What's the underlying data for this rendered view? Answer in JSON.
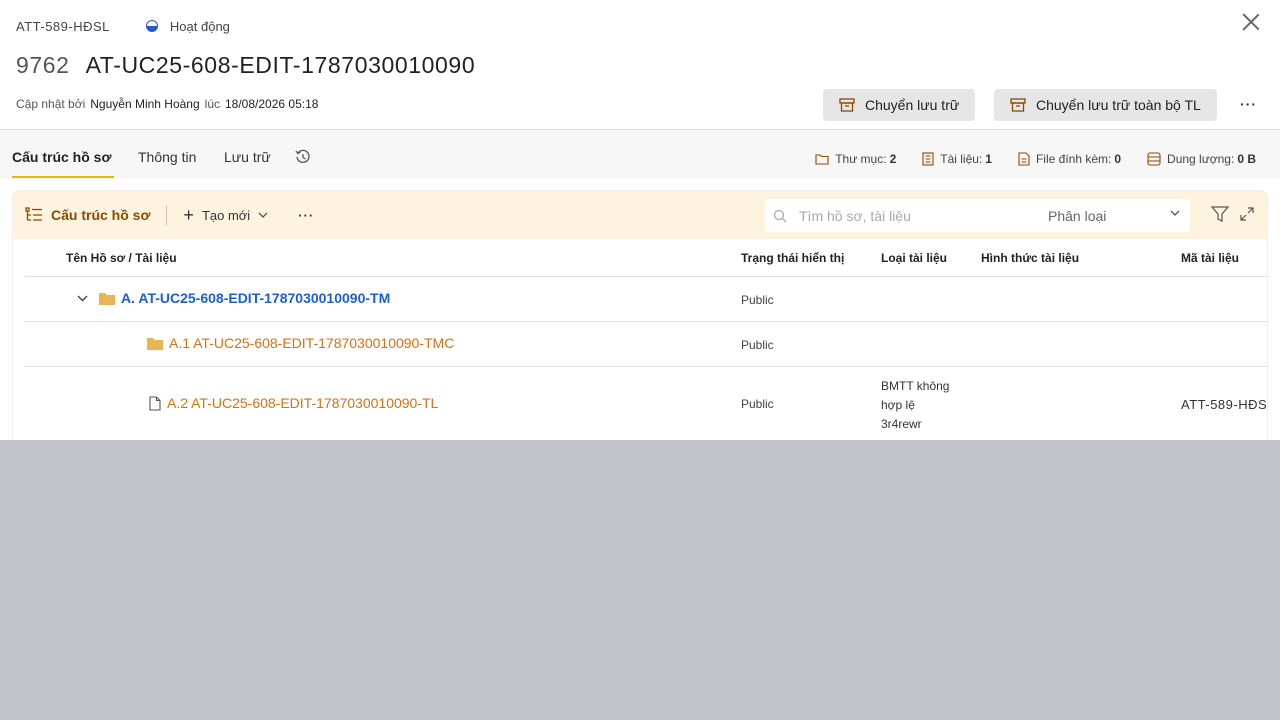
{
  "header": {
    "code": "ATT-589-HĐSL",
    "status": "Hoạt động",
    "number": "9762",
    "title": "AT-UC25-608-EDIT-1787030010090",
    "updated_prefix": "Cập nhật bởi",
    "updated_by": "Nguyễn Minh Hoàng",
    "updated_at_prefix": "lúc",
    "updated_at": "18/08/2026 05:18",
    "btn_archive": "Chuyển lưu trữ",
    "btn_archive_all": "Chuyển lưu trữ toàn bộ TL",
    "more": "···"
  },
  "tabs": [
    {
      "label": "Cấu trúc hồ sơ",
      "active": true
    },
    {
      "label": "Thông tin"
    },
    {
      "label": "Lưu trữ"
    }
  ],
  "stats": [
    {
      "label": "Thư mục:",
      "value": "2",
      "icon": "folder-icon"
    },
    {
      "label": "Tài liệu:",
      "value": "1",
      "icon": "document-icon"
    },
    {
      "label": "File đính kèm:",
      "value": "0",
      "icon": "attachment-icon"
    },
    {
      "label": "Dung lượng:",
      "value": "0 B",
      "icon": "storage-icon"
    }
  ],
  "toolbar": {
    "title": "Cấu trúc hồ sơ",
    "new_label": "Tạo mới",
    "dots": "···",
    "search_placeholder": "Tìm hồ sơ, tài liệu",
    "category_placeholder": "Phân loại"
  },
  "table": {
    "columns": [
      "Tên Hồ sơ / Tài liệu",
      "Trạng thái hiển thị",
      "Loại tài liệu",
      "Hình thức tài liệu",
      "Mã tài liệu"
    ],
    "rows": [
      {
        "name": "A. AT-UC25-608-EDIT-1787030010090-TM",
        "status": "Public",
        "type": "",
        "form": "",
        "code": "",
        "kind": "folder"
      },
      {
        "name": "A.1 AT-UC25-608-EDIT-1787030010090-TMC",
        "status": "Public",
        "type": "",
        "form": "",
        "code": "",
        "kind": "folder"
      },
      {
        "name": "A.2 AT-UC25-608-EDIT-1787030010090-TL",
        "status": "Public",
        "type_lines": [
          "BMTT không",
          "hợp lệ",
          "3r4rewr"
        ],
        "form": "",
        "code": "ATT-589-HĐS",
        "kind": "file"
      }
    ]
  },
  "colors": {
    "accent_blue": "#1d5fd1",
    "accent_orange": "#d0731a",
    "toolbar_bg": "#fdf3df",
    "tab_underline": "#f0b400",
    "folder": "#e8b454"
  }
}
